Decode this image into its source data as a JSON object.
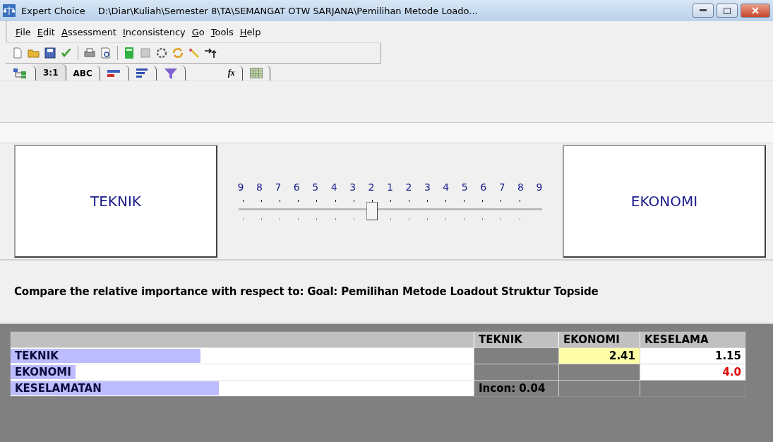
{
  "window": {
    "app": "Expert Choice",
    "title": "D:\\Diar\\Kuliah\\Semester 8\\TA\\SEMANGAT OTW SARJANA\\Pemilihan Metode Loado..."
  },
  "menu": [
    "File",
    "Edit",
    "Assessment",
    "Inconsistency",
    "Go",
    "Tools",
    "Help"
  ],
  "tabs": [
    {
      "kind": "icon",
      "selected": false
    },
    {
      "kind": "text",
      "label": "3:1",
      "selected": true
    },
    {
      "kind": "text",
      "label": "ABC",
      "selected": false
    },
    {
      "kind": "icon",
      "selected": false
    },
    {
      "kind": "icon",
      "selected": false
    },
    {
      "kind": "icon",
      "selected": false
    },
    {
      "kind": "text",
      "label": "fx",
      "selected": false
    },
    {
      "kind": "icon",
      "selected": false
    }
  ],
  "comparison": {
    "left": "TEKNIK",
    "right": "EKONOMI",
    "scale": [
      "9",
      "8",
      "7",
      "6",
      "5",
      "4",
      "3",
      "2",
      "1",
      "2",
      "3",
      "4",
      "5",
      "6",
      "7",
      "8",
      "9"
    ],
    "level": 0.4375
  },
  "prompt": "Compare the relative importance with respect to: Goal: Pemilihan Metode Loadout Struktur Topside",
  "matrix": {
    "columns": [
      "TEKNIK",
      "EKONOMI",
      "KESELAMA"
    ],
    "rows": [
      {
        "name": "TEKNIK",
        "level": 0.41,
        "cells": [
          {
            "kind": "blank"
          },
          {
            "kind": "value",
            "text": "2.41",
            "selected": true,
            "inverted": false
          },
          {
            "kind": "value",
            "text": "1.15",
            "selected": false,
            "inverted": false
          }
        ]
      },
      {
        "name": "EKONOMI",
        "level": 0.14,
        "cells": [
          {
            "kind": "blank"
          },
          {
            "kind": "blank"
          },
          {
            "kind": "value",
            "text": "4.0",
            "selected": false,
            "inverted": true
          }
        ]
      },
      {
        "name": "KESELAMATAN",
        "level": 0.45,
        "cells": [
          {
            "kind": "note",
            "text": "Incon: 0.04"
          },
          {
            "kind": "blank"
          },
          {
            "kind": "blank"
          }
        ]
      }
    ]
  }
}
